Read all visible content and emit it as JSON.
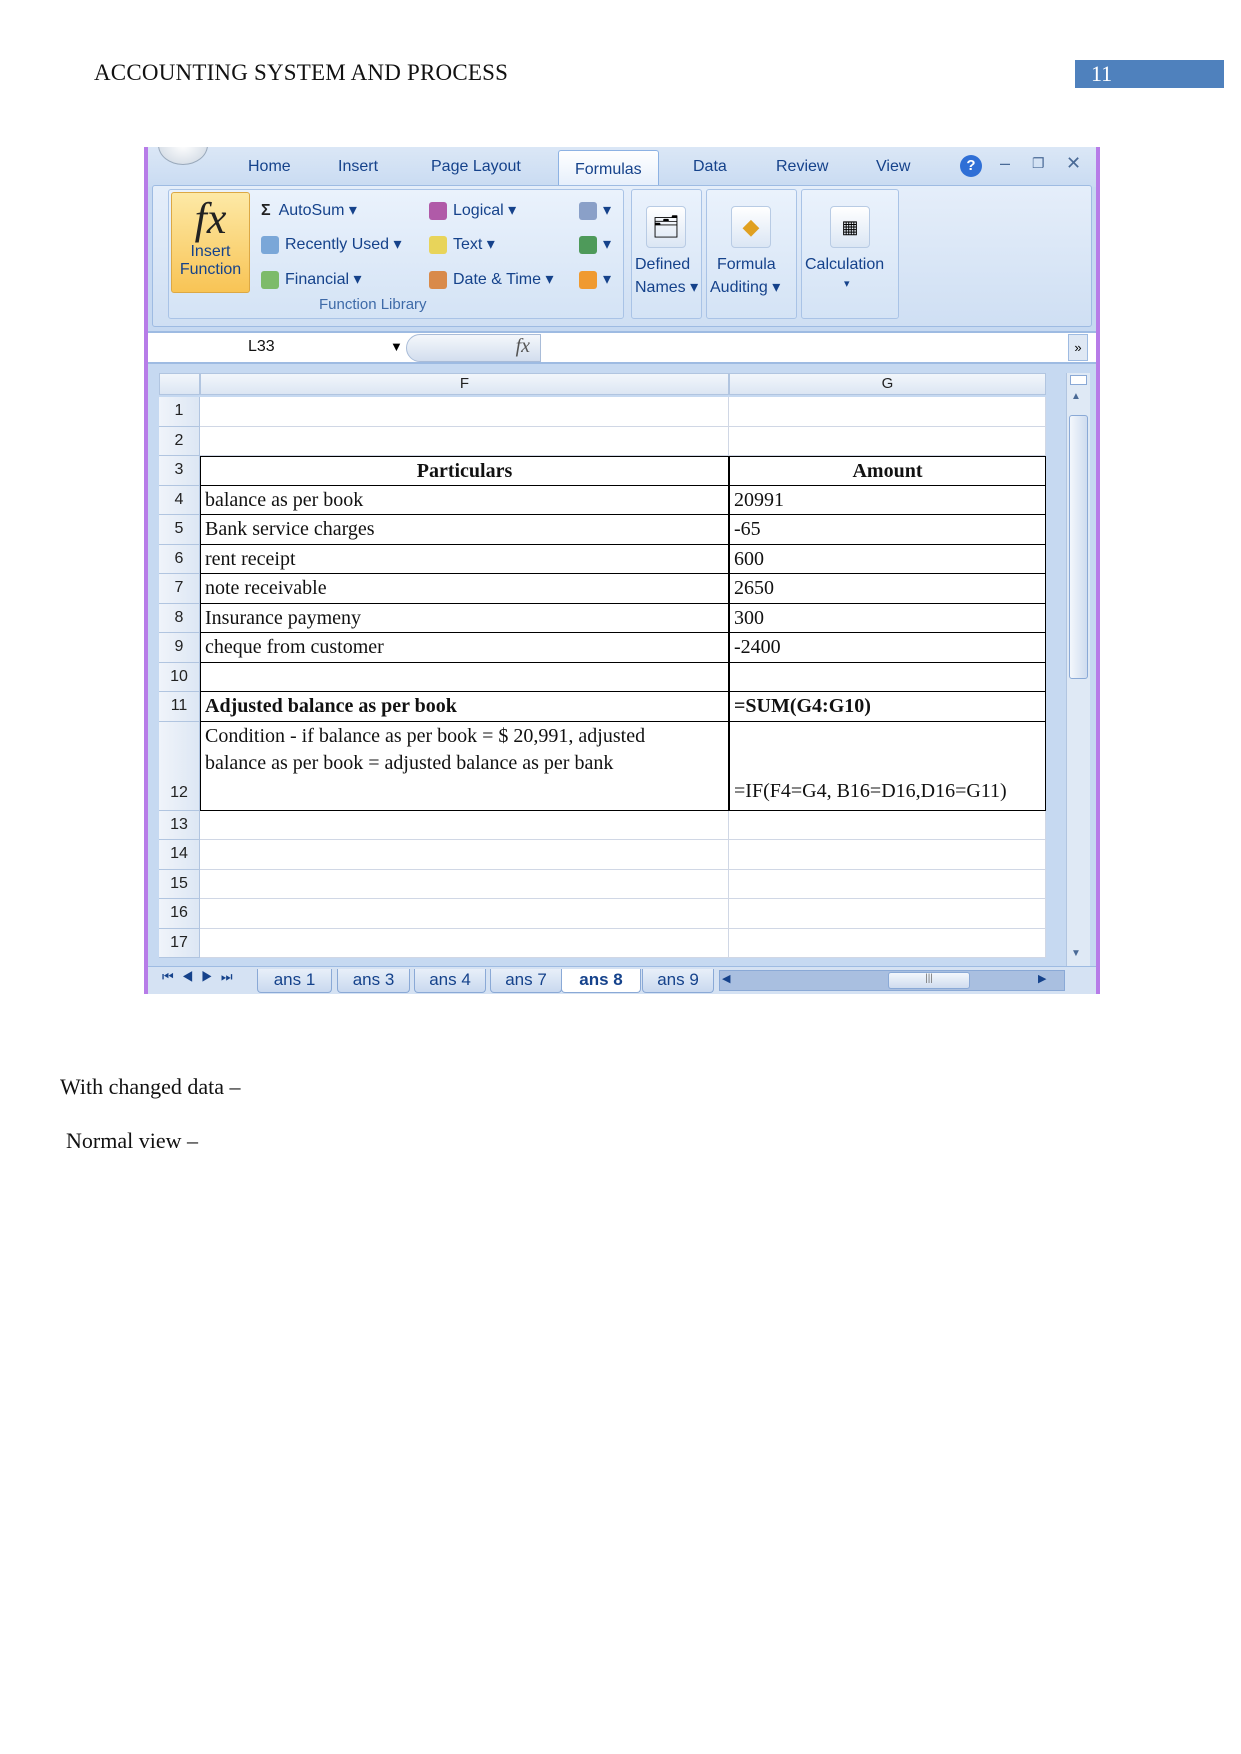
{
  "header": {
    "title": "ACCOUNTING SYSTEM AND PROCESS",
    "page_number": "11",
    "badge_color": "#4f81bd"
  },
  "excel": {
    "tabs": [
      "Home",
      "Insert",
      "Page Layout",
      "Formulas",
      "Data",
      "Review",
      "View"
    ],
    "active_tab": "Formulas",
    "window_icons": [
      "help-icon",
      "minimize-icon",
      "restore-icon",
      "close-icon"
    ],
    "ribbon": {
      "insert_function": {
        "line1": "Insert",
        "line2": "Function",
        "icon": "fx"
      },
      "autosum": "AutoSum",
      "recently_used": "Recently Used",
      "financial": "Financial",
      "logical": "Logical",
      "text": "Text",
      "date_time": "Date & Time",
      "group_label": "Function Library",
      "defined_names": {
        "line1": "Defined",
        "line2": "Names"
      },
      "formula_auditing": {
        "line1": "Formula",
        "line2": "Auditing"
      },
      "calculation": "Calculation"
    },
    "formula_bar": {
      "name_box": "L33",
      "fx": "fx",
      "formula": ""
    },
    "columns": [
      "F",
      "G"
    ],
    "rows": [
      {
        "n": "1",
        "f": "",
        "g": ""
      },
      {
        "n": "2",
        "f": "",
        "g": ""
      },
      {
        "n": "3",
        "f": "Particulars",
        "g": "Amount"
      },
      {
        "n": "4",
        "f": "balance as per book",
        "g": "20991"
      },
      {
        "n": "5",
        "f": "Bank service charges",
        "g": "-65"
      },
      {
        "n": "6",
        "f": "rent receipt",
        "g": "600"
      },
      {
        "n": "7",
        "f": "note receivable",
        "g": "2650"
      },
      {
        "n": "8",
        "f": "Insurance paymeny",
        "g": "300"
      },
      {
        "n": "9",
        "f": "cheque from customer",
        "g": "-2400"
      },
      {
        "n": "10",
        "f": "",
        "g": ""
      },
      {
        "n": "11",
        "f": "Adjusted balance as per book",
        "g": "=SUM(G4:G10)"
      },
      {
        "n": "12",
        "f": "Condition - if balance as per book = $ 20,991, adjusted",
        "f2": "balance as per book = adjusted balance as per bank",
        "g": "=IF(F4=G4, B16=D16,D16=G11)"
      },
      {
        "n": "13",
        "f": "",
        "g": ""
      },
      {
        "n": "14",
        "f": "",
        "g": ""
      },
      {
        "n": "15",
        "f": "",
        "g": ""
      },
      {
        "n": "16",
        "f": "",
        "g": ""
      },
      {
        "n": "17",
        "f": "",
        "g": ""
      }
    ],
    "sheet_tabs": [
      "ans 1",
      "ans 3",
      "ans 4",
      "ans 7",
      "ans 8",
      "ans 9"
    ],
    "active_sheet": "ans 8"
  },
  "body": {
    "line1": "With changed data –",
    "line2": "Normal view –"
  }
}
